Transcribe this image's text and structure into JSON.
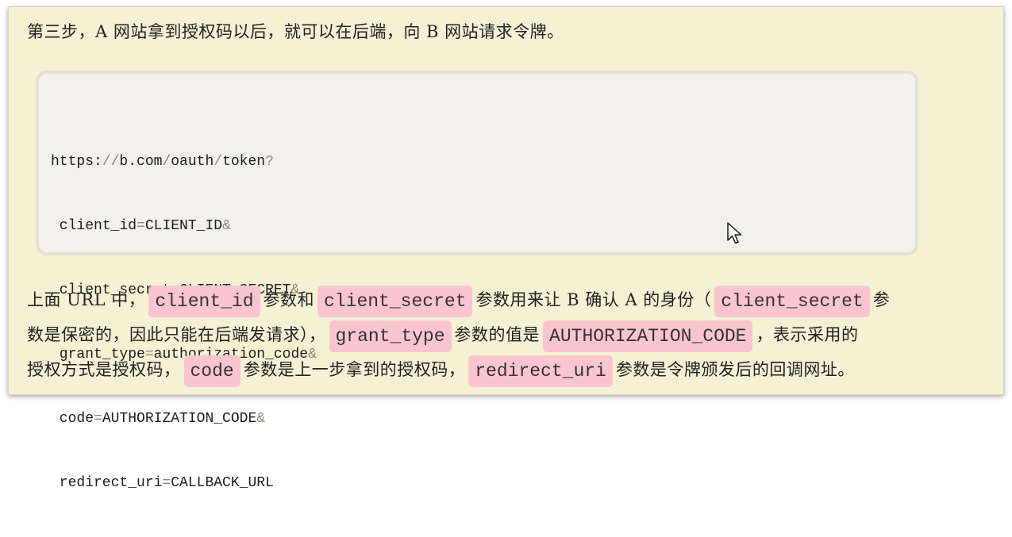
{
  "intro_text": "第三步，A 网站拿到授权码以后，就可以在后端，向 B 网站请求令牌。",
  "code": {
    "line1": {
      "a": "https:",
      "b": "//",
      "c": "b.com",
      "d": "/",
      "e": "oauth",
      "f": "/",
      "g": "token",
      "h": "?"
    },
    "line2": {
      "key": " client_id",
      "eq": "=",
      "val": "CLIENT_ID",
      "amp": "&"
    },
    "line3": {
      "key": " client_secret",
      "eq": "=",
      "val": "CLIENT_SECRET",
      "amp": "&"
    },
    "line4": {
      "key": " grant_type",
      "eq": "=",
      "val": "authorization_code",
      "amp": "&"
    },
    "line5": {
      "key": " code",
      "eq": "=",
      "val": "AUTHORIZATION_CODE",
      "amp": "&"
    },
    "line6": {
      "key": " redirect_uri",
      "eq": "=",
      "val": "CALLBACK_URL"
    }
  },
  "explanation": {
    "r1_a": "上面 URL 中，",
    "r1_tag1": "client_id",
    "r1_b": "参数和",
    "r1_tag2": "client_secret",
    "r1_c": "参数用来让 B 确认 A 的身份（",
    "r1_tag3": "client_secret",
    "r1_d": "参",
    "r2_a": "数是保密的，因此只能在后端发请求），",
    "r2_tag1": "grant_type",
    "r2_b": "参数的值是",
    "r2_tag2": "AUTHORIZATION_CODE",
    "r2_c": "，表示采用的",
    "r3_a": "授权方式是授权码，",
    "r3_tag1": "code",
    "r3_b": "参数是上一步拿到的授权码，",
    "r3_tag2": "redirect_uri",
    "r3_c": "参数是令牌颁发后的回调网址。"
  },
  "icons": {
    "cursor": "mouse-pointer-icon"
  },
  "colors": {
    "page_background": "#f4f1d4",
    "code_background": "#f3f1ee",
    "tag_background": "#fbc5cf"
  }
}
